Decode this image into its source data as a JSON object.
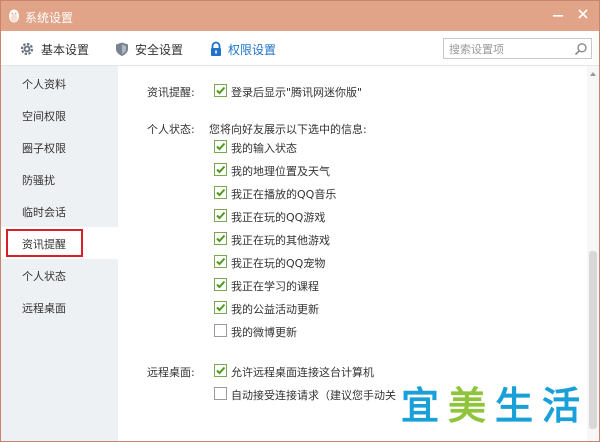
{
  "window": {
    "title": "系统设置"
  },
  "tabs": [
    {
      "label": "基本设置",
      "icon": "gear-icon"
    },
    {
      "label": "安全设置",
      "icon": "shield-icon"
    },
    {
      "label": "权限设置",
      "icon": "lock-icon",
      "active": true
    }
  ],
  "search": {
    "placeholder": "搜索设置项"
  },
  "sidebar": {
    "items": [
      {
        "label": "个人资料"
      },
      {
        "label": "空间权限"
      },
      {
        "label": "圈子权限"
      },
      {
        "label": "防骚扰"
      },
      {
        "label": "临时会话"
      },
      {
        "label": "资讯提醒",
        "selected": true
      },
      {
        "label": "个人状态"
      },
      {
        "label": "远程桌面"
      }
    ]
  },
  "content": {
    "news_reminder": {
      "label": "资讯提醒:",
      "option": {
        "label": "登录后显示\"腾讯网迷你版\"",
        "checked": true
      }
    },
    "personal_status": {
      "label": "个人状态:",
      "description": "您将向好友展示以下选中的信息:",
      "options": [
        {
          "label": "我的输入状态",
          "checked": true
        },
        {
          "label": "我的地理位置及天气",
          "checked": true
        },
        {
          "label": "我正在播放的QQ音乐",
          "checked": true
        },
        {
          "label": "我正在玩的QQ游戏",
          "checked": true
        },
        {
          "label": "我正在玩的其他游戏",
          "checked": true
        },
        {
          "label": "我正在玩的QQ宠物",
          "checked": true
        },
        {
          "label": "我正在学习的课程",
          "checked": true
        },
        {
          "label": "我的公益活动更新",
          "checked": true
        },
        {
          "label": "我的微博更新",
          "checked": false
        }
      ]
    },
    "remote_desktop": {
      "label": "远程桌面:",
      "options": [
        {
          "label": "允许远程桌面连接这台计算机",
          "checked": true
        },
        {
          "label": "自动接受连接请求（建议您手动关",
          "checked": false
        }
      ]
    }
  },
  "watermark": {
    "chars": [
      "宜",
      "美",
      "生",
      "活"
    ]
  },
  "colors": {
    "titlebar": "#e1a488",
    "accent": "#1f73c9",
    "selection_outline": "#d8202a",
    "checkbox_check": "#4e9a1f",
    "sidebar_bg": "#eef1f4",
    "watermark_fill": "#1aa0d8",
    "watermark_fill_2": "#8fc43c"
  }
}
